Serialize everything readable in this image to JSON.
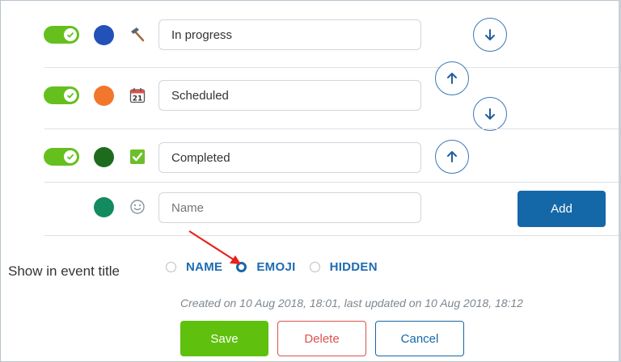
{
  "statuses": [
    {
      "name": "In progress",
      "color": "#2451b7",
      "icon": "hammer-icon",
      "enabled": true
    },
    {
      "name": "Scheduled",
      "color": "#f2762b",
      "icon": "calendar-icon",
      "calendar_day": "21",
      "enabled": true
    },
    {
      "name": "Completed",
      "color": "#1f6b1d",
      "icon": "check-box-icon",
      "enabled": true
    }
  ],
  "new_status": {
    "placeholder": "Name",
    "color": "#138a60",
    "icon": "smiley-icon",
    "add_label": "Add"
  },
  "event_title": {
    "label": "Show in event title",
    "options": [
      {
        "label": "NAME",
        "checked": false
      },
      {
        "label": "EMOJI",
        "checked": true
      },
      {
        "label": "HIDDEN",
        "checked": false
      }
    ]
  },
  "meta": "Created on 10 Aug 2018, 18:01, last updated on 10 Aug 2018, 18:12",
  "actions": {
    "save": "Save",
    "delete": "Delete",
    "cancel": "Cancel"
  },
  "colors": {
    "toggle_on": "#65c01e",
    "primary": "#1568a8",
    "danger": "#d9534f",
    "save": "#5fc10e",
    "annotation": "#e8221b"
  }
}
